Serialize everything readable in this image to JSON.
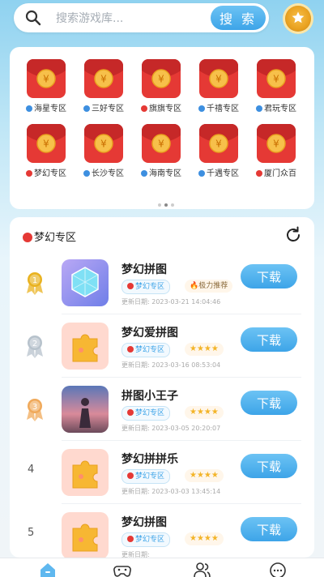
{
  "search": {
    "placeholder": "搜索游戏库...",
    "button_label": "搜 索"
  },
  "zones": [
    {
      "label": "海星专区",
      "dot_color": "#3d8fe0"
    },
    {
      "label": "三好专区",
      "dot_color": "#3d8fe0"
    },
    {
      "label": "旗旗专区",
      "dot_color": "#e53935"
    },
    {
      "label": "千禧专区",
      "dot_color": "#3d8fe0"
    },
    {
      "label": "君玩专区",
      "dot_color": "#3d8fe0"
    },
    {
      "label": "梦幻专区",
      "dot_color": "#e53935"
    },
    {
      "label": "长沙专区",
      "dot_color": "#3d8fe0"
    },
    {
      "label": "海南专区",
      "dot_color": "#3d8fe0"
    },
    {
      "label": "千遇专区",
      "dot_color": "#3d8fe0"
    },
    {
      "label": "厦门众百",
      "dot_color": "#e53935"
    }
  ],
  "pager": {
    "count": 3,
    "active": 1
  },
  "list": {
    "title": "梦幻专区",
    "download_label": "下载",
    "update_prefix": "更新日期:",
    "items": [
      {
        "rank": "1",
        "name": "梦幻拼图",
        "zone": "梦幻专区",
        "extra": "🔥极力推荐",
        "date": "2023-03-21 14:04:46"
      },
      {
        "rank": "2",
        "name": "梦幻爱拼图",
        "zone": "梦幻专区",
        "extra": "★★★★",
        "date": "2023-03-16 08:53:04"
      },
      {
        "rank": "3",
        "name": "拼图小王子",
        "zone": "梦幻专区",
        "extra": "★★★★",
        "date": "2023-03-05 20:20:07"
      },
      {
        "rank": "4",
        "name": "梦幻拼拼乐",
        "zone": "梦幻专区",
        "extra": "★★★★",
        "date": "2023-03-03 13:45:14"
      },
      {
        "rank": "5",
        "name": "梦幻拼图",
        "zone": "梦幻专区",
        "extra": "★★★★",
        "date": ""
      }
    ]
  },
  "colors": {
    "accent": "#3da4e8",
    "envelope": "#e53935",
    "coin": "#f7c04a"
  },
  "tabs": [
    {
      "icon": "home-icon"
    },
    {
      "icon": "gamepad-icon"
    },
    {
      "icon": "users-icon"
    },
    {
      "icon": "chat-icon"
    }
  ]
}
